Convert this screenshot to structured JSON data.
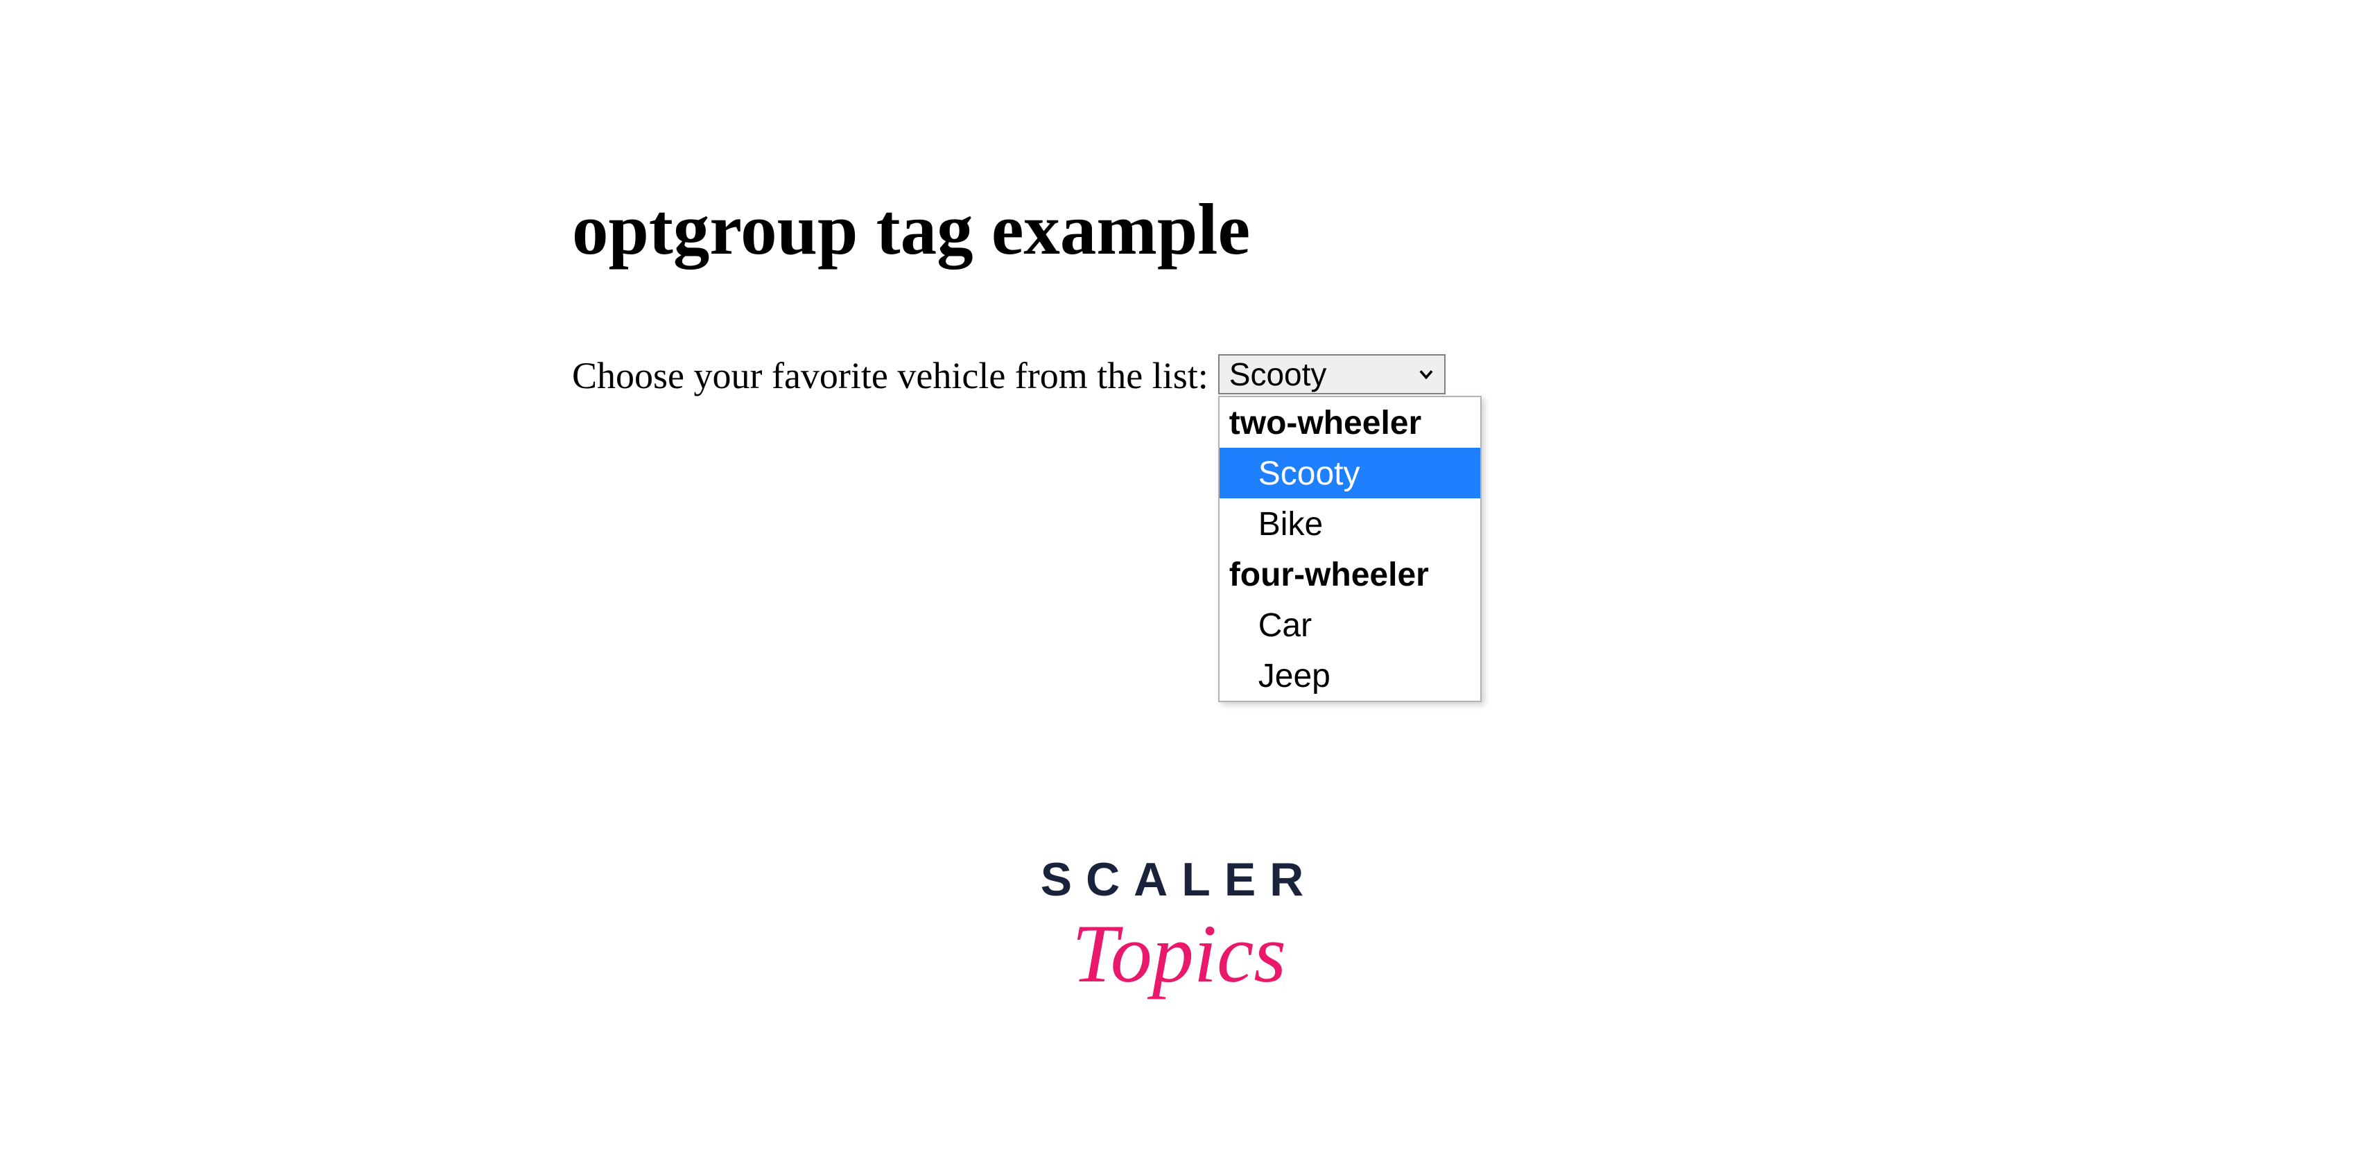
{
  "heading": "optgroup tag example",
  "form": {
    "label": "Choose your favorite vehicle from the list:",
    "selected": "Scooty",
    "groups": [
      {
        "label": "two-wheeler",
        "options": [
          {
            "label": "Scooty",
            "highlighted": true
          },
          {
            "label": "Bike",
            "highlighted": false
          }
        ]
      },
      {
        "label": "four-wheeler",
        "options": [
          {
            "label": "Car",
            "highlighted": false
          },
          {
            "label": "Jeep",
            "highlighted": false
          }
        ]
      }
    ]
  },
  "logo": {
    "line1": "SCALER",
    "line2": "Topics"
  }
}
